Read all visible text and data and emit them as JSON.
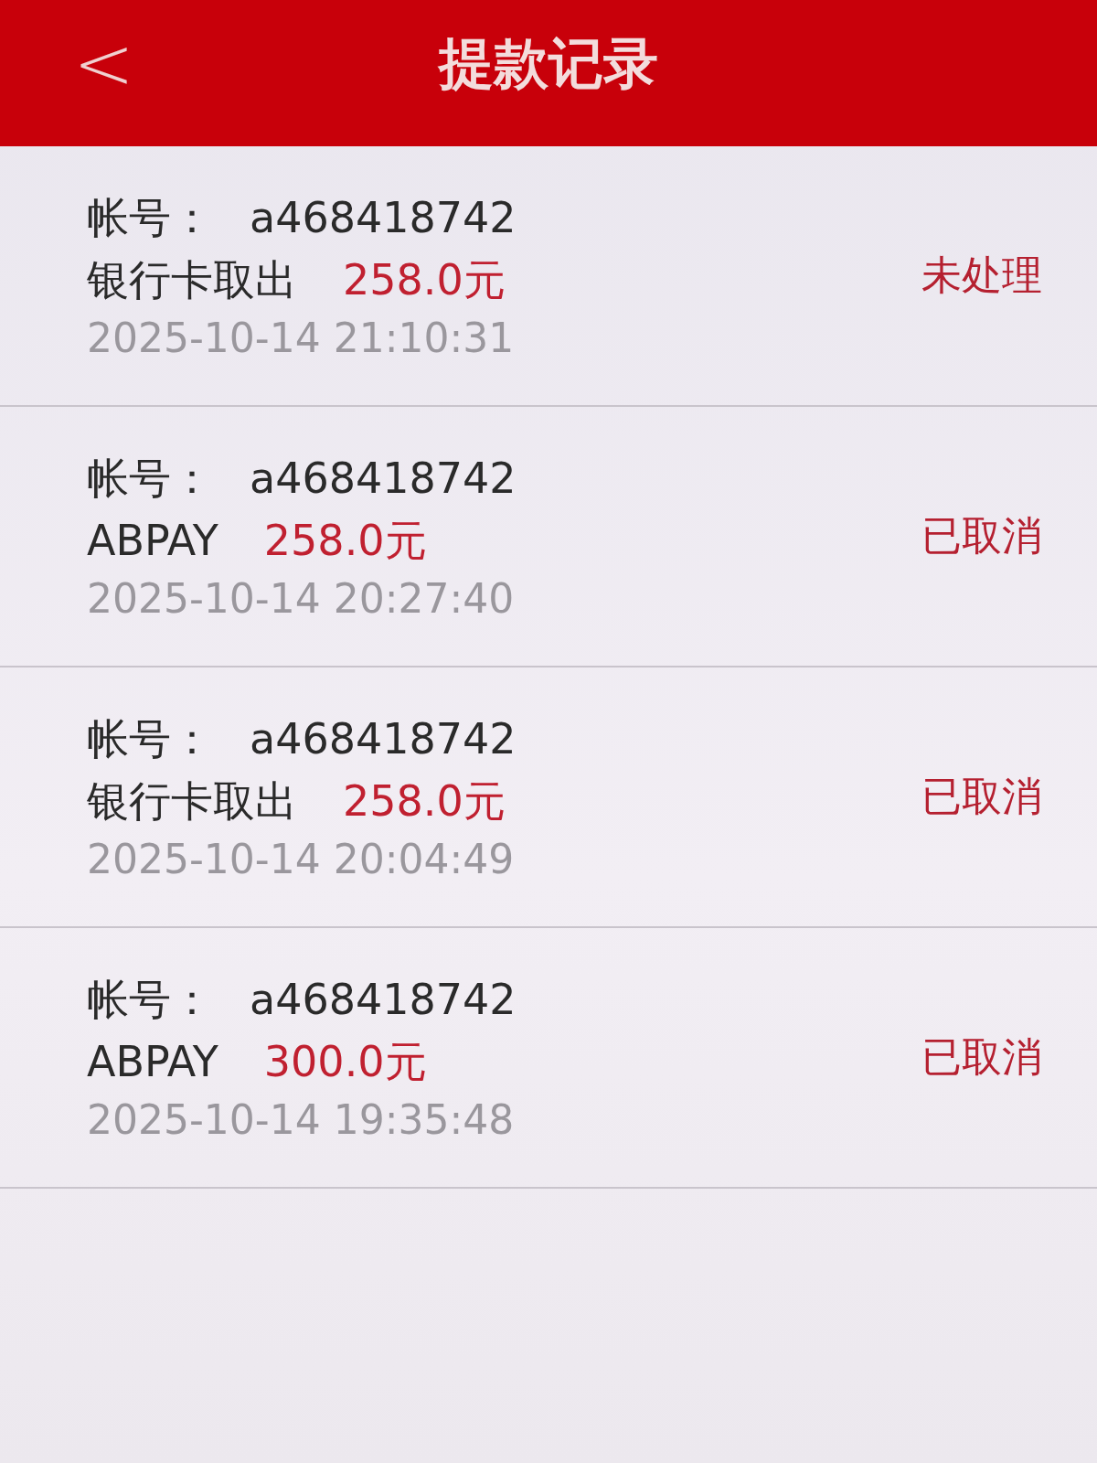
{
  "header": {
    "back": "<",
    "title": "提款记录"
  },
  "records": [
    {
      "account_label": "帐号：",
      "account": "a468418742",
      "method": "银行卡取出",
      "amount": "258.0元",
      "time": "2025-10-14 21:10:31",
      "status": "未处理"
    },
    {
      "account_label": "帐号：",
      "account": "a468418742",
      "method": "ABPAY",
      "amount": "258.0元",
      "time": "2025-10-14 20:27:40",
      "status": "已取消"
    },
    {
      "account_label": "帐号：",
      "account": "a468418742",
      "method": "银行卡取出",
      "amount": "258.0元",
      "time": "2025-10-14 20:04:49",
      "status": "已取消"
    },
    {
      "account_label": "帐号：",
      "account": "a468418742",
      "method": "ABPAY",
      "amount": "300.0元",
      "time": "2025-10-14 19:35:48",
      "status": "已取消"
    }
  ]
}
